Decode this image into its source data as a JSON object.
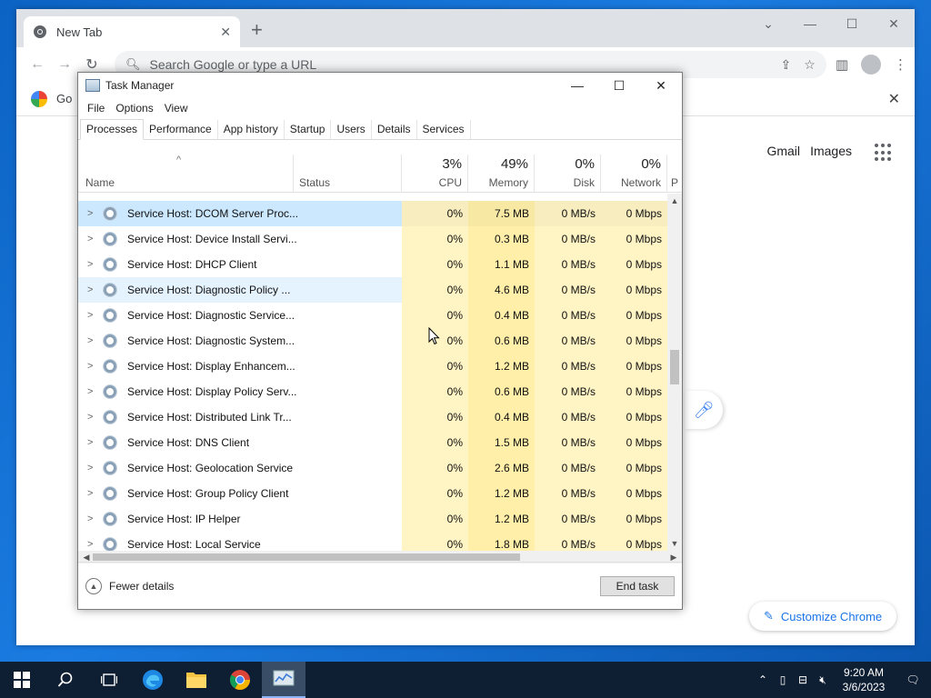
{
  "chrome": {
    "tab_title": "New Tab",
    "tab_close": "✕",
    "new_tab": "+",
    "omnibox_placeholder": "Search Google or type a URL",
    "bar2_label": "Go",
    "gmail": "Gmail",
    "images": "Images",
    "customize": "Customize Chrome"
  },
  "taskmanager": {
    "title": "Task Manager",
    "menu": [
      "File",
      "Options",
      "View"
    ],
    "tabs": [
      "Processes",
      "Performance",
      "App history",
      "Startup",
      "Users",
      "Details",
      "Services"
    ],
    "columns": {
      "name": "Name",
      "status": "Status",
      "cpu_pct": "3%",
      "cpu": "CPU",
      "mem_pct": "49%",
      "mem": "Memory",
      "disk_pct": "0%",
      "disk": "Disk",
      "net_pct": "0%",
      "net": "Network",
      "power": "P"
    },
    "rows": [
      {
        "name": "Service Host: DCOM Server Proc...",
        "cpu": "0%",
        "mem": "7.5 MB",
        "disk": "0 MB/s",
        "net": "0 Mbps"
      },
      {
        "name": "Service Host: Device Install Servi...",
        "cpu": "0%",
        "mem": "0.3 MB",
        "disk": "0 MB/s",
        "net": "0 Mbps"
      },
      {
        "name": "Service Host: DHCP Client",
        "cpu": "0%",
        "mem": "1.1 MB",
        "disk": "0 MB/s",
        "net": "0 Mbps"
      },
      {
        "name": "Service Host: Diagnostic Policy ...",
        "cpu": "0%",
        "mem": "4.6 MB",
        "disk": "0 MB/s",
        "net": "0 Mbps"
      },
      {
        "name": "Service Host: Diagnostic Service...",
        "cpu": "0%",
        "mem": "0.4 MB",
        "disk": "0 MB/s",
        "net": "0 Mbps"
      },
      {
        "name": "Service Host: Diagnostic System...",
        "cpu": "0%",
        "mem": "0.6 MB",
        "disk": "0 MB/s",
        "net": "0 Mbps"
      },
      {
        "name": "Service Host: Display Enhancem...",
        "cpu": "0%",
        "mem": "1.2 MB",
        "disk": "0 MB/s",
        "net": "0 Mbps"
      },
      {
        "name": "Service Host: Display Policy Serv...",
        "cpu": "0%",
        "mem": "0.6 MB",
        "disk": "0 MB/s",
        "net": "0 Mbps"
      },
      {
        "name": "Service Host: Distributed Link Tr...",
        "cpu": "0%",
        "mem": "0.4 MB",
        "disk": "0 MB/s",
        "net": "0 Mbps"
      },
      {
        "name": "Service Host: DNS Client",
        "cpu": "0%",
        "mem": "1.5 MB",
        "disk": "0 MB/s",
        "net": "0 Mbps"
      },
      {
        "name": "Service Host: Geolocation Service",
        "cpu": "0%",
        "mem": "2.6 MB",
        "disk": "0 MB/s",
        "net": "0 Mbps"
      },
      {
        "name": "Service Host: Group Policy Client",
        "cpu": "0%",
        "mem": "1.2 MB",
        "disk": "0 MB/s",
        "net": "0 Mbps"
      },
      {
        "name": "Service Host: IP Helper",
        "cpu": "0%",
        "mem": "1.2 MB",
        "disk": "0 MB/s",
        "net": "0 Mbps"
      },
      {
        "name": "Service Host: Local Service",
        "cpu": "0%",
        "mem": "1.8 MB",
        "disk": "0 MB/s",
        "net": "0 Mbps"
      }
    ],
    "fewer_details": "Fewer details",
    "end_task": "End task"
  },
  "taskbar": {
    "time": "9:20 AM",
    "date": "3/6/2023"
  },
  "icons": {
    "tab_favicon": "chrome-icon",
    "system": [
      "start-icon",
      "search-icon",
      "task-view-icon",
      "edge-icon",
      "file-explorer-icon",
      "chrome-icon",
      "task-manager-icon"
    ]
  }
}
